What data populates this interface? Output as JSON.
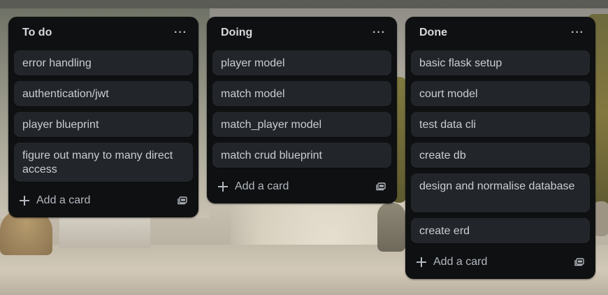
{
  "lists": [
    {
      "title": "To do",
      "menu_label": "···",
      "cards": [
        "error handling",
        "authentication/jwt",
        "player blueprint",
        "figure out many to many direct access"
      ],
      "add_label": "Add a card"
    },
    {
      "title": "Doing",
      "menu_label": "···",
      "cards": [
        "player model",
        "match model",
        "match_player model",
        "match crud blueprint"
      ],
      "add_label": "Add a card"
    },
    {
      "title": "Done",
      "menu_label": "···",
      "cards": [
        "basic flask setup",
        "court model",
        "test data cli",
        "create db",
        "design and normalise database",
        "create erd"
      ],
      "add_label": "Add a card"
    }
  ],
  "icons": {
    "menu": "more-horizontal-icon",
    "add": "plus-icon",
    "template": "card-template-icon"
  },
  "colors": {
    "list_bg": "#0f1011",
    "card_bg": "#22262b",
    "text": "#c9ced4",
    "title": "#d5d9de"
  }
}
